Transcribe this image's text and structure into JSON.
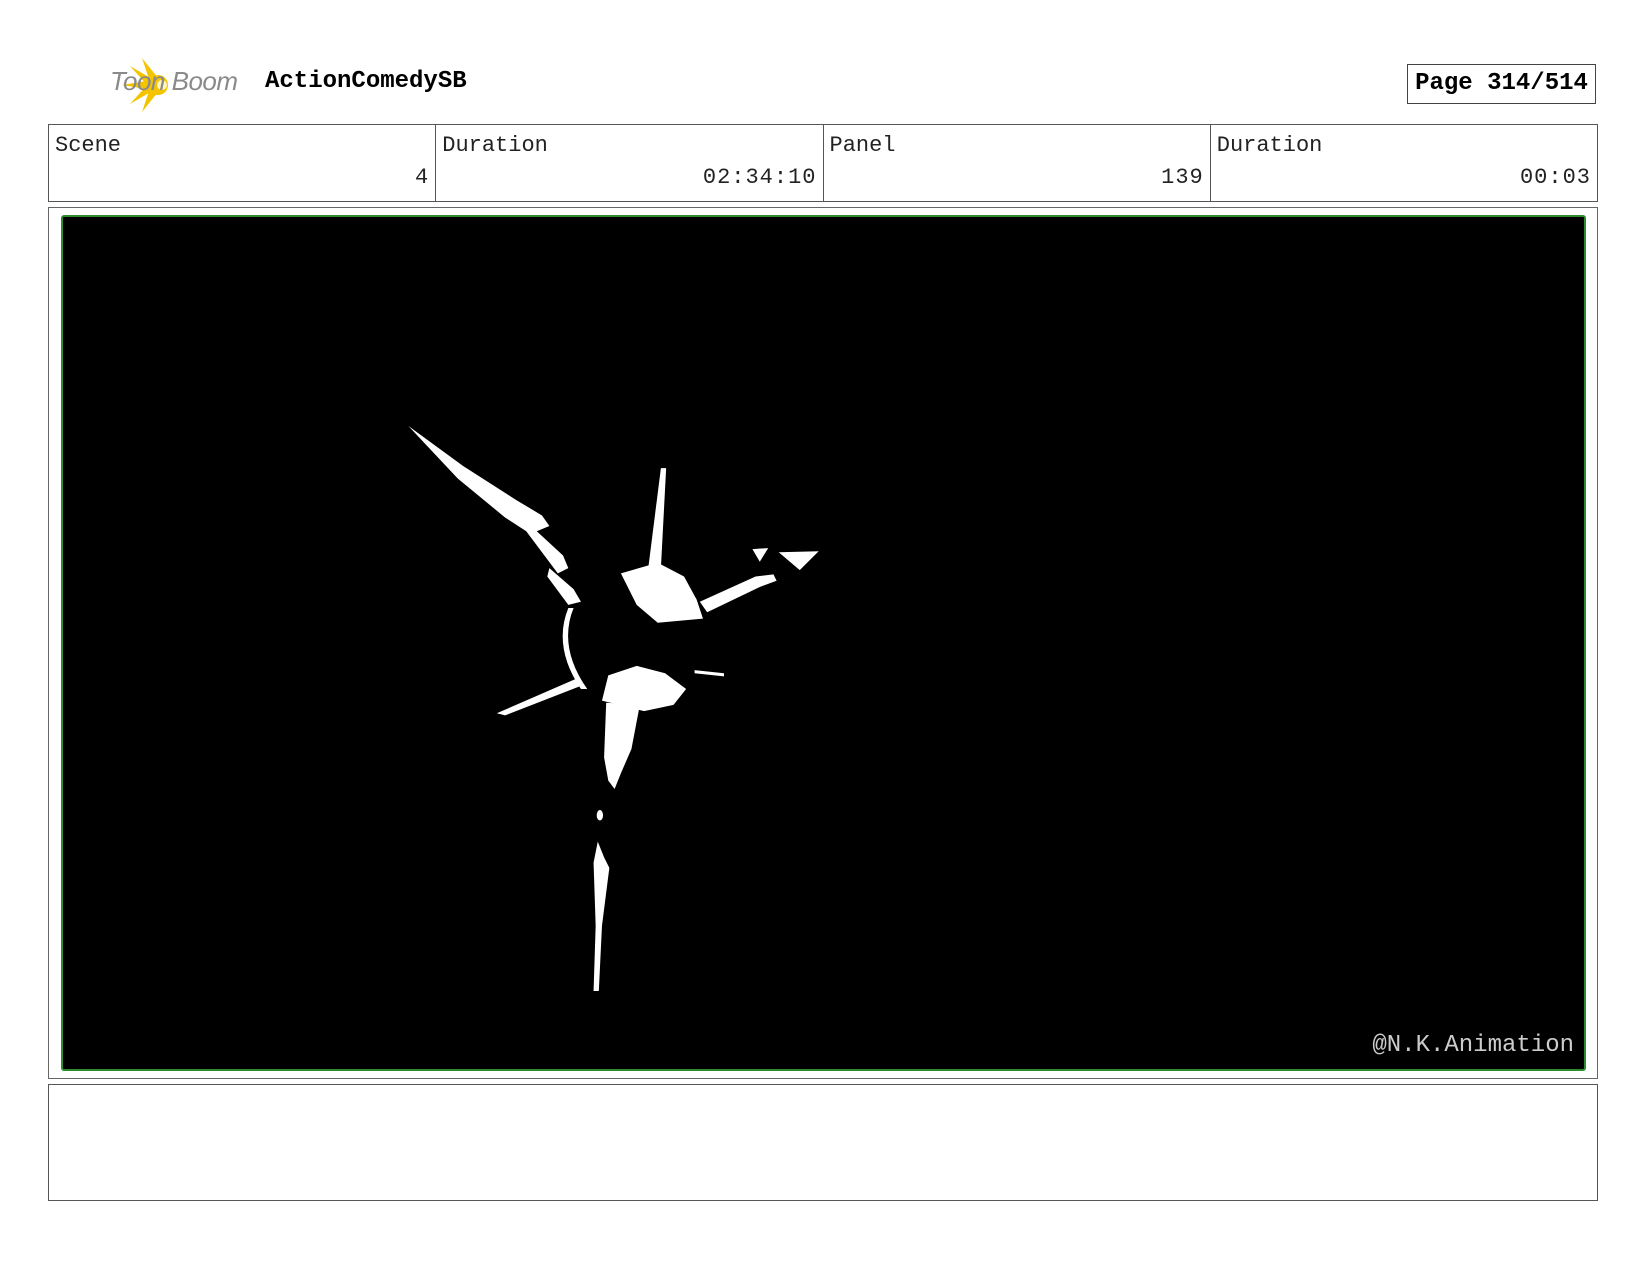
{
  "header": {
    "logo_text": "Toon Boom",
    "project_title": "ActionComedySB",
    "page_label": "Page 314/514"
  },
  "info": {
    "scene_label": "Scene",
    "scene_value": "4",
    "scene_duration_label": "Duration",
    "scene_duration_value": "02:34:10",
    "panel_label": "Panel",
    "panel_value": "139",
    "panel_duration_label": "Duration",
    "panel_duration_value": "00:03"
  },
  "panel": {
    "watermark": "@N.K.Animation",
    "frame_color": "#2e8b2e",
    "background": "#000000"
  },
  "notes": {}
}
